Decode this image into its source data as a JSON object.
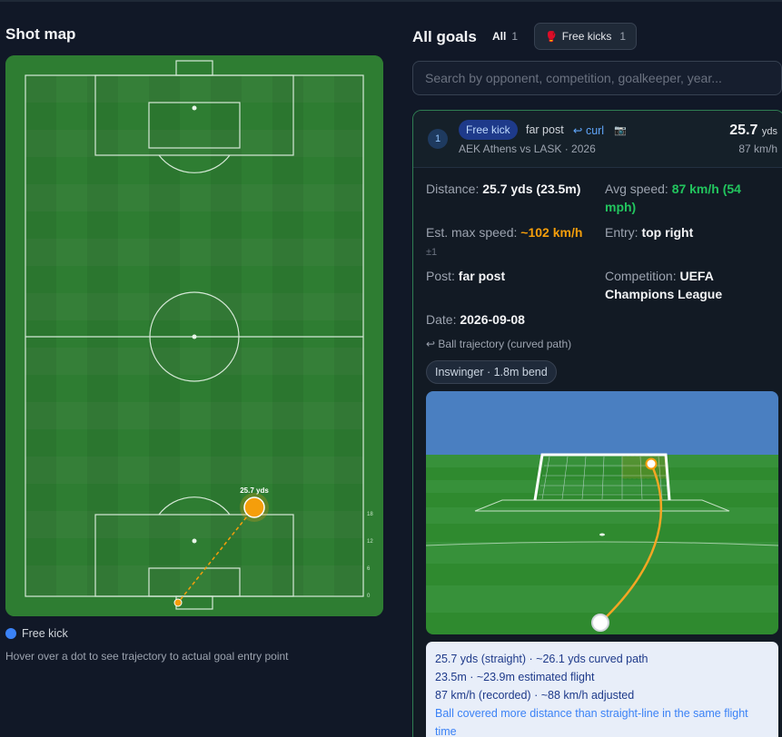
{
  "shot_map": {
    "title": "Shot map",
    "marker_label": "25.7 yds",
    "ruler_labels": [
      "18",
      "12",
      "6",
      "0"
    ],
    "legend_label": "Free kick",
    "hint": "Hover over a dot to see trajectory to actual goal entry point"
  },
  "goals": {
    "title": "All goals",
    "filter_all": {
      "label": "All",
      "count": "1"
    },
    "filter_free_kicks": {
      "label": "Free kicks",
      "count": "1",
      "icon": "boot-icon"
    },
    "search_placeholder": "Search by opponent, competition, goalkeeper, year..."
  },
  "goal_card": {
    "number": "1",
    "type_badge": "Free kick",
    "post": "far post",
    "curl": "↩ curl",
    "camera_icon": "📷",
    "match": "AEK Athens vs LASK · 2026",
    "distance": "25.7",
    "distance_unit": "yds",
    "speed": "87 km/h",
    "stats": {
      "distance_label": "Distance:",
      "distance_value": "25.7 yds (23.5m)",
      "avg_speed_label": "Avg speed:",
      "avg_speed_value": "87 km/h (54 mph)",
      "max_speed_label": "Est. max speed:",
      "max_speed_value": "~102 km/h",
      "max_speed_pm": "±1",
      "entry_label": "Entry:",
      "entry_value": "top right",
      "post_label": "Post:",
      "post_value": "far post",
      "competition_label": "Competition:",
      "competition_value": "UEFA Champions League",
      "date_label": "Date:",
      "date_value": "2026-09-08"
    },
    "trajectory_label": "↩ Ball trajectory (curved path)",
    "swing_badge": "Inswinger · 1.8m bend",
    "info": {
      "line1": "25.7 yds (straight) · ~26.1 yds curved path",
      "line2": "23.5m · ~23.9m estimated flight",
      "line3": "87 km/h (recorded) · ~88 km/h adjusted",
      "note": "Ball covered more distance than straight-line in the same flight time"
    }
  },
  "colors": {
    "background": "#111827",
    "pitch_dark": "#2e7d32",
    "marker": "#f59e0b",
    "accent_green": "#22c55e",
    "free_kick_blue": "#3b82f6"
  }
}
